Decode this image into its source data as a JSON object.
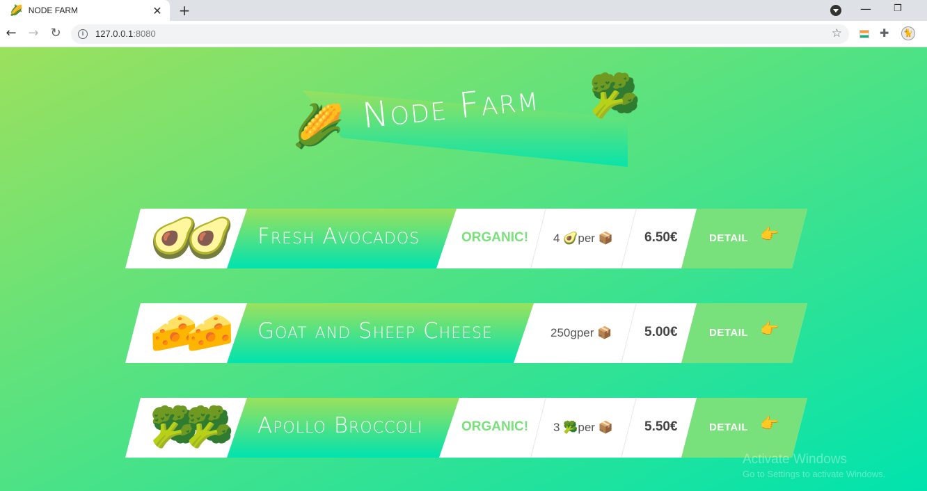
{
  "browser": {
    "tab_favicon": "🌽",
    "tab_title": "NODE FARM",
    "tab_close": "✕",
    "new_tab": "+",
    "url_host": "127.0.0.1",
    "url_port": ":8080",
    "back": "←",
    "forward": "→",
    "reload": "↻",
    "star": "☆",
    "puzzle": "✚",
    "minimize": "—",
    "restore": "❐",
    "avatar": "🐈"
  },
  "hero": {
    "title": "Node Farm",
    "left_emoji": "🌽",
    "right_emoji": "🥦"
  },
  "products": [
    {
      "emoji": "🥑🥑",
      "name": "Fresh Avocados",
      "organic": "ORGANIC!",
      "quantity_num": "4",
      "quantity_emoji": "🥑",
      "quantity_per": "per",
      "box_emoji": "📦",
      "price": "6.50€",
      "detail": "DETAIL",
      "hand": "👉"
    },
    {
      "emoji": "🧀🧀",
      "name": "Goat and Sheep Cheese",
      "organic": "",
      "quantity_num": "250gper",
      "quantity_emoji": "",
      "quantity_per": "",
      "box_emoji": "📦",
      "price": "5.00€",
      "detail": "DETAIL",
      "hand": "👉"
    },
    {
      "emoji": "🥦🥦",
      "name": "Apollo Broccoli",
      "organic": "ORGANIC!",
      "quantity_num": "3",
      "quantity_emoji": "🥦",
      "quantity_per": "per",
      "box_emoji": "📦",
      "price": "5.50€",
      "detail": "DETAIL",
      "hand": "👉"
    }
  ],
  "watermark": {
    "line1": "Activate Windows",
    "line2": "Go to Settings to activate Windows."
  }
}
